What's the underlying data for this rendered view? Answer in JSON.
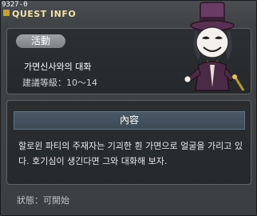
{
  "window": {
    "id_label": "9327-0",
    "title": "QUEST INFO"
  },
  "quest": {
    "type_badge": "活動",
    "name": "가면신사와의 대화",
    "level_label": "建議等級：",
    "level_range": "10～14"
  },
  "content": {
    "header": "內容",
    "description": "할로윈 파티의 주재자는 기괴한 흰 가면으로 얼굴을 가리고 있다. 호기심이 생긴다면 그와 대화해 보자."
  },
  "status": {
    "label": "狀態：",
    "value": "可開始"
  },
  "npc": {
    "icon": "masked-gentleman-npc-icon"
  }
}
